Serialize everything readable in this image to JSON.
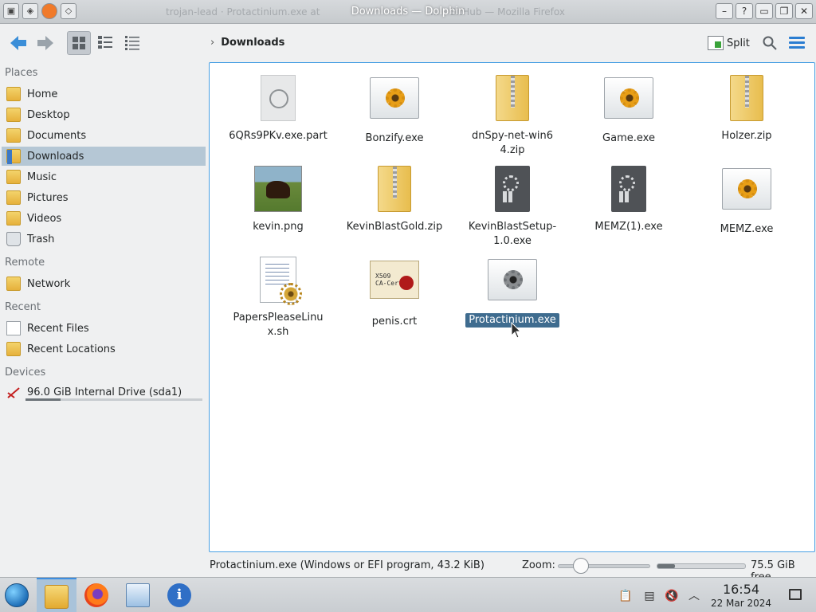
{
  "window": {
    "title": "Downloads — Dolphin",
    "background_title_left": "trojan-lead · Protactinium.exe at",
    "background_title_right": "... · GitHub — Mozilla Firefox"
  },
  "toolbar": {
    "back_icon": "arrow-left-icon",
    "forward_icon": "arrow-right-icon",
    "breadcrumb": "Downloads",
    "split_label": "Split"
  },
  "sidebar": {
    "sections": [
      {
        "title": "Places",
        "items": [
          {
            "label": "Home",
            "icon": "home-folder-icon"
          },
          {
            "label": "Desktop",
            "icon": "desktop-folder-icon"
          },
          {
            "label": "Documents",
            "icon": "documents-folder-icon"
          },
          {
            "label": "Downloads",
            "icon": "downloads-folder-icon",
            "selected": true
          },
          {
            "label": "Music",
            "icon": "music-folder-icon"
          },
          {
            "label": "Pictures",
            "icon": "pictures-folder-icon"
          },
          {
            "label": "Videos",
            "icon": "videos-folder-icon"
          },
          {
            "label": "Trash",
            "icon": "trash-icon"
          }
        ]
      },
      {
        "title": "Remote",
        "items": [
          {
            "label": "Network",
            "icon": "network-folder-icon"
          }
        ]
      },
      {
        "title": "Recent",
        "items": [
          {
            "label": "Recent Files",
            "icon": "recent-files-icon"
          },
          {
            "label": "Recent Locations",
            "icon": "recent-locations-icon"
          }
        ]
      },
      {
        "title": "Devices",
        "items": [
          {
            "label": "96.0 GiB Internal Drive (sda1)",
            "icon": "hard-drive-icon",
            "usage_fraction": 0.2
          }
        ]
      }
    ]
  },
  "files": [
    {
      "name": "6QRs9PKv.exe.part",
      "type": "part"
    },
    {
      "name": "Bonzify.exe",
      "type": "exe"
    },
    {
      "name": "dnSpy-net-win64.zip",
      "type": "zip"
    },
    {
      "name": "Game.exe",
      "type": "exe"
    },
    {
      "name": "Holzer.zip",
      "type": "zip"
    },
    {
      "name": "kevin.png",
      "type": "png"
    },
    {
      "name": "KevinBlastGold.zip",
      "type": "zip"
    },
    {
      "name": "KevinBlastSetup-1.0.exe",
      "type": "bin"
    },
    {
      "name": "MEMZ(1).exe",
      "type": "bin"
    },
    {
      "name": "MEMZ.exe",
      "type": "exe"
    },
    {
      "name": "PapersPleaseLinux.sh",
      "type": "sh"
    },
    {
      "name": "penis.crt",
      "type": "crt",
      "cert_text": "X509\nCA-Cert"
    },
    {
      "name": "Protactinium.exe",
      "type": "exe-gray",
      "selected": true
    }
  ],
  "status": {
    "text": "Protactinium.exe (Windows or EFI program, 43.2 KiB)",
    "zoom_label": "Zoom:",
    "zoom_fraction": 0.25,
    "free_space": "75.5 GiB free",
    "used_fraction": 0.2
  },
  "taskbar": {
    "time": "16:54",
    "date": "22 Mar 2024"
  }
}
